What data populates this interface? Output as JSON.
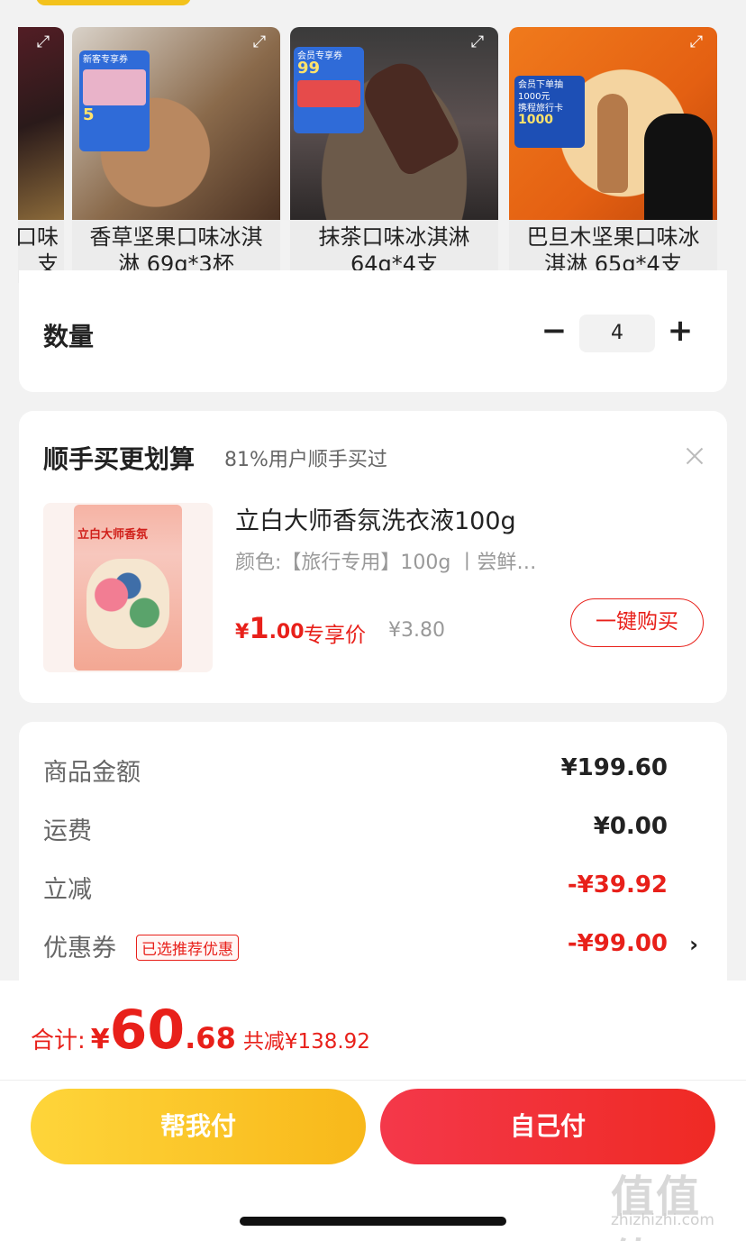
{
  "variants": [
    {
      "label": "口味\n支",
      "line1": "口味",
      "line2": "支"
    },
    {
      "line1": "香草坚果口味冰淇",
      "line2": "淋 69g*3杯"
    },
    {
      "line1": "抹茶口味冰淇淋",
      "line2": "64g*4支"
    },
    {
      "line1": "巴旦木坚果口味冰",
      "line2": "淇淋 65g*4支"
    }
  ],
  "promo": {
    "v1_top": "新客专享券",
    "v1_amount": "5",
    "v2_top": "会员专享券",
    "v2_amount": "99",
    "v3_top": "会员下单抽1000元",
    "v3_sub": "携程旅行卡",
    "v3_amount": "1000"
  },
  "quantity": {
    "label": "数量",
    "minus": "−",
    "value": "4",
    "plus": "+"
  },
  "addon": {
    "title": "顺手买更划算",
    "stat": "81%用户顺手买过",
    "product_name": "立白大师香氛洗衣液100g",
    "pack_brand": "立白大师香氛",
    "spec": "颜色:【旅行专用】100g 丨尝鲜…",
    "price_symbol": "¥",
    "price_int": "1",
    "price_dec": ".00",
    "price_tag": "专享价",
    "original_price": "¥3.80",
    "buy_label": "一键购买"
  },
  "summary": {
    "rows": [
      {
        "label": "商品金额",
        "value": "¥199.60"
      },
      {
        "label": "运费",
        "value": "¥0.00"
      },
      {
        "label": "立减",
        "value": "-¥39.92"
      },
      {
        "label": "优惠券",
        "value": "-¥99.00"
      }
    ],
    "coupon_badge": "已选推荐优惠",
    "chevron": "›"
  },
  "total": {
    "label": "合计:",
    "symbol": "¥",
    "int": "60",
    "dec": ".68",
    "saving": "共减¥138.92"
  },
  "buttons": {
    "help_pay": "帮我付",
    "self_pay": "自己付"
  },
  "watermark": {
    "glyphs": "值值值",
    "site": "zhizhizhi.com"
  },
  "colors": {
    "accent_red": "#e8201a",
    "yellow": "#f8b81a"
  }
}
